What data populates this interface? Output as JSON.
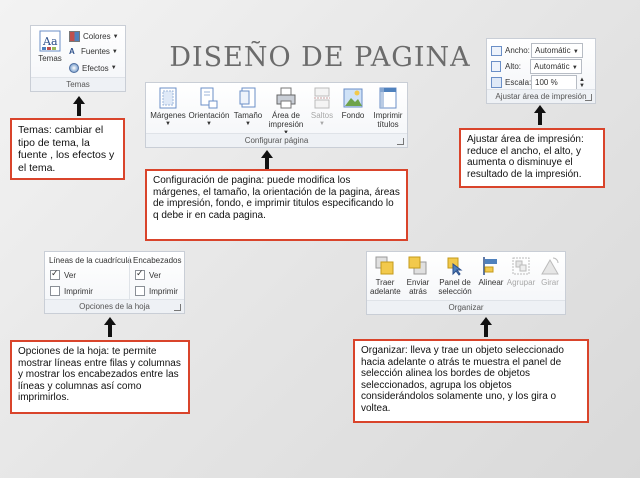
{
  "title": "DISEÑO DE PAGINA",
  "themes_panel": {
    "big_label": "Temas",
    "items": [
      "Colores",
      "Fuentes",
      "Efectos"
    ],
    "footer": "Temas"
  },
  "page_setup_panel": {
    "buttons": [
      {
        "label": "Márgenes",
        "icon": "margins-icon"
      },
      {
        "label": "Orientación",
        "icon": "orientation-icon"
      },
      {
        "label": "Tamaño",
        "icon": "size-icon"
      },
      {
        "label": "Área de impresión",
        "icon": "print-area-icon"
      },
      {
        "label": "Saltos",
        "icon": "breaks-icon"
      },
      {
        "label": "Fondo",
        "icon": "background-icon"
      },
      {
        "label": "Imprimir títulos",
        "icon": "print-titles-icon"
      }
    ],
    "footer": "Configurar página"
  },
  "scale_panel": {
    "rows": [
      {
        "label": "Ancho:",
        "value": "Automátic"
      },
      {
        "label": "Alto:",
        "value": "Automátic"
      },
      {
        "label": "Escala:",
        "value": "100 %"
      }
    ],
    "footer": "Ajustar área de impresión"
  },
  "sheet_options_panel": {
    "col1_header": "Líneas de la cuadrícula",
    "col2_header": "Encabezados",
    "ver_label": "Ver",
    "imprimir_label": "Imprimir",
    "footer": "Opciones de la hoja"
  },
  "arrange_panel": {
    "buttons": [
      {
        "label": "Traer adelante",
        "icon": "bring-forward-icon"
      },
      {
        "label": "Enviar atrás",
        "icon": "send-backward-icon"
      },
      {
        "label": "Panel de selección",
        "icon": "selection-pane-icon"
      },
      {
        "label": "Alinear",
        "icon": "align-icon"
      },
      {
        "label": "Agrupar",
        "icon": "group-icon"
      },
      {
        "label": "Girar",
        "icon": "rotate-icon"
      }
    ],
    "footer": "Organizar"
  },
  "notes": {
    "temas": "Temas: cambiar el tipo de tema, la fuente , los efectos y el tema.",
    "config": "Configuración de pagina: puede modifica los márgenes, el tamaño, la orientación de la pagina, áreas de impresión, fondo, e imprimir titulos especificando lo q debe ir en cada pagina.",
    "ajustar": "Ajustar área de impresión: reduce el ancho, el alto, y aumenta o disminuye el resultado de la impresión.",
    "opciones_a": "Opciones de la hoja",
    "opciones_b": ": te permite mostrar líneas entre filas y columnas y mostrar los encabezados entre las líneas y columnas así como imprimirlos.",
    "organizar": "Organizar: lleva y trae un objeto seleccionado hacia adelante o atrás te muestra el panel de selección alinea los bordes de objetos seleccionados, agrupa los objetos considerándolos  solamente uno, y los gira o voltea."
  }
}
